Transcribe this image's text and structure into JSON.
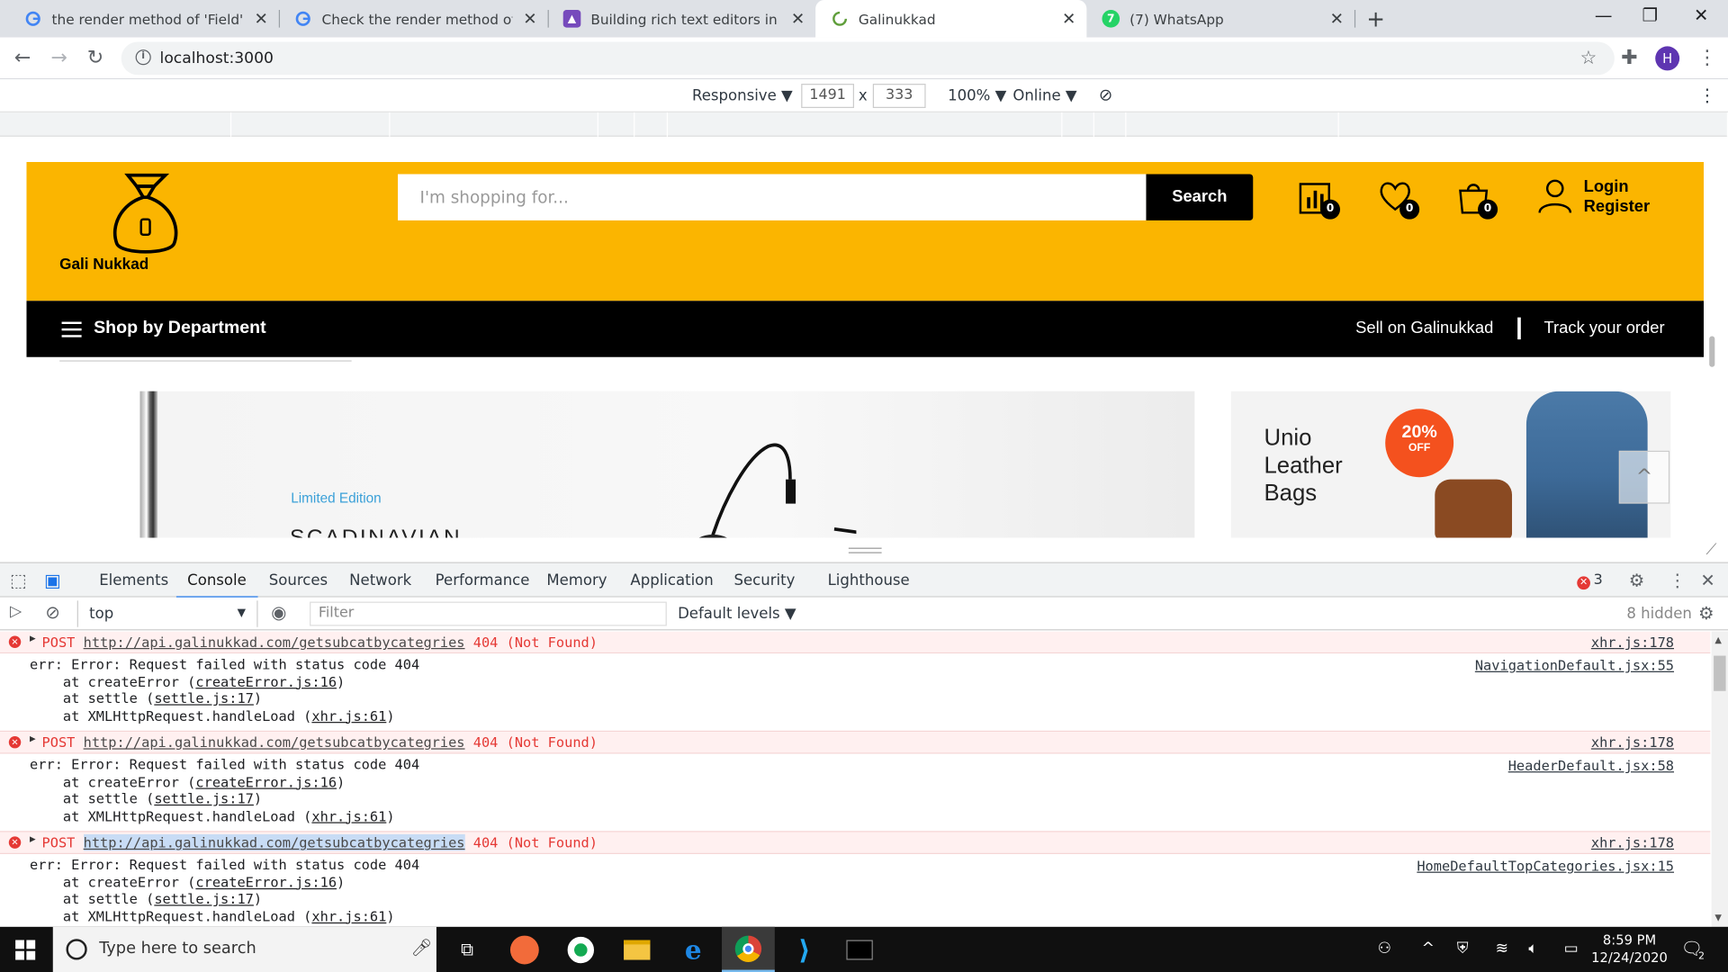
{
  "browser": {
    "tabs": [
      {
        "title": "the render method of 'Field'. in T",
        "favicon": "google-icon",
        "active": false
      },
      {
        "title": "Check the render method of 'Fiel",
        "favicon": "google-icon",
        "active": false
      },
      {
        "title": "Building rich text editors in React",
        "favicon": "logrocket-icon",
        "active": false
      },
      {
        "title": "Galinukkad",
        "favicon": "loading-icon",
        "active": true
      },
      {
        "title": "(7) WhatsApp",
        "favicon": "whatsapp-icon",
        "active": false
      }
    ],
    "new_tab": "+",
    "address": "localhost:3000",
    "profile_initial": "H"
  },
  "device_toolbar": {
    "mode": "Responsive ▼",
    "width": "1491",
    "times": "x",
    "height": "333",
    "zoom": "100% ▼",
    "network": "Online ▼"
  },
  "site": {
    "logo_text": "Gali Nukkad",
    "search_placeholder": "I'm shopping for...",
    "search_button": "Search",
    "compare_count": "0",
    "wishlist_count": "0",
    "cart_count": "0",
    "login": "Login",
    "register": "Register",
    "shop_by_department": "Shop by Department",
    "sell_link": "Sell on Galinukkad",
    "track_link": "Track your order",
    "banner_main": {
      "tag": "Limited Edition",
      "title": "SCADINAVIAN"
    },
    "banner_side": {
      "line1": "Unio",
      "line2": "Leather",
      "line3": "Bags",
      "discount": "20%",
      "discount_sub": "OFF"
    },
    "scroll_top": "^"
  },
  "devtools": {
    "tabs": [
      "Elements",
      "Console",
      "Sources",
      "Network",
      "Performance",
      "Memory",
      "Application",
      "Security",
      "Lighthouse"
    ],
    "active_tab": "Console",
    "error_count": "3",
    "context": "top",
    "filter_placeholder": "Filter",
    "levels": "Default levels ▼",
    "hidden": "8 hidden",
    "messages": [
      {
        "method": "POST",
        "url": "http://api.galinukkad.com/getsubcatbycategries",
        "status": "404 (Not Found)",
        "source": "xhr.js:178",
        "log_source": "NavigationDefault.jsx:55",
        "selected": false
      },
      {
        "method": "POST",
        "url": "http://api.galinukkad.com/getsubcatbycategries",
        "status": "404 (Not Found)",
        "source": "xhr.js:178",
        "log_source": "HeaderDefault.jsx:58",
        "selected": false
      },
      {
        "method": "POST",
        "url": "http://api.galinukkad.com/getsubcatbycategries",
        "status": "404 (Not Found)",
        "source": "xhr.js:178",
        "log_source": "HomeDefaultTopCategories.jsx:15",
        "selected": true
      }
    ],
    "log": {
      "err_line": "err: Error: Request failed with status code 404",
      "at": "    at ",
      "frame1_fn": "createError (",
      "frame1_src": "createError.js:16",
      "frame2_fn": "settle (",
      "frame2_src": "settle.js:17",
      "frame3_fn": "XMLHttpRequest.handleLoad (",
      "frame3_src": "xhr.js:61",
      "close": ")"
    }
  },
  "taskbar": {
    "search_placeholder": "Type here to search",
    "time": "8:59 PM",
    "date": "12/24/2020",
    "notification_count": "2"
  },
  "colors": {
    "brand_yellow": "#fbb500",
    "error_red": "#e53935",
    "devtools_accent": "#1a73e8"
  }
}
